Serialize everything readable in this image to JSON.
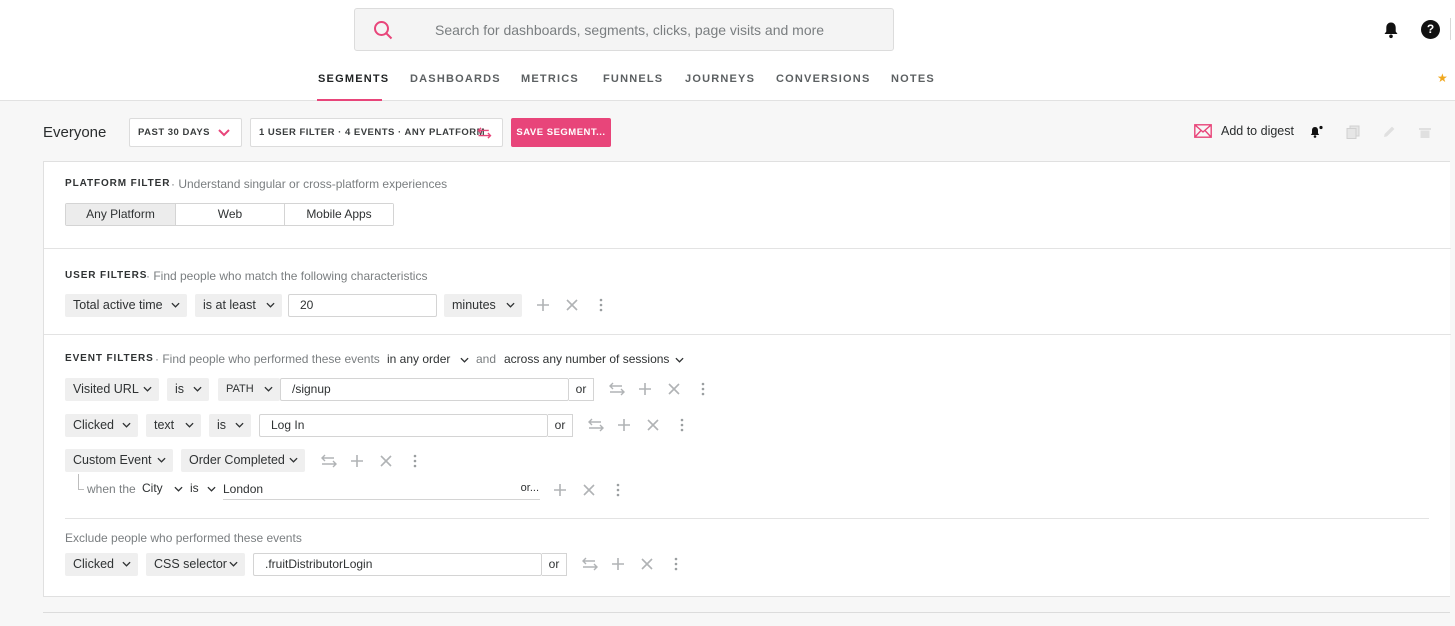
{
  "search": {
    "placeholder": "Search for dashboards, segments, clicks, page visits and more"
  },
  "header": {
    "help_label": "?"
  },
  "nav": {
    "tabs": [
      "SEGMENTS",
      "DASHBOARDS",
      "METRICS",
      "FUNNELS",
      "JOURNEYS",
      "CONVERSIONS",
      "NOTES"
    ],
    "active": "SEGMENTS"
  },
  "segment": {
    "title": "Everyone",
    "date_range": "PAST 30 DAYS",
    "summary": "1 USER FILTER · 4 EVENTS · ANY PLATFORM",
    "save_label": "SAVE SEGMENT...",
    "digest_label": "Add to digest"
  },
  "platform": {
    "heading": "PLATFORM FILTER",
    "subtitle": "· Understand singular or cross-platform experiences",
    "options": [
      "Any Platform",
      "Web",
      "Mobile Apps"
    ],
    "selected": "Any Platform"
  },
  "user_filters": {
    "heading": "USER FILTERS",
    "subtitle": "· Find people who match the following characteristics",
    "property": "Total active time",
    "operator": "is at least",
    "value": "20",
    "unit": "minutes"
  },
  "event_filters": {
    "heading": "EVENT FILTERS",
    "subtitle": "· Find people who performed these events",
    "order": "in any order",
    "and_label": "and",
    "sessions": "across any number of sessions",
    "rows": [
      {
        "event": "Visited URL",
        "operator": "is",
        "field": "PATH",
        "value": "/signup",
        "or": "or"
      },
      {
        "event": "Clicked",
        "field": "text",
        "operator": "is",
        "value": "Log In",
        "or": "or"
      },
      {
        "event": "Custom Event",
        "name": "Order Completed",
        "condition": {
          "when_label": "when the",
          "property": "City",
          "operator": "is",
          "value": "London",
          "or": "or..."
        }
      }
    ],
    "exclude_label": "Exclude people who performed these events",
    "exclude_row": {
      "event": "Clicked",
      "field": "CSS selector",
      "value": ".fruitDistributorLogin",
      "or": "or"
    }
  },
  "colors": {
    "accent": "#e8457a",
    "star": "#f0a81f"
  }
}
